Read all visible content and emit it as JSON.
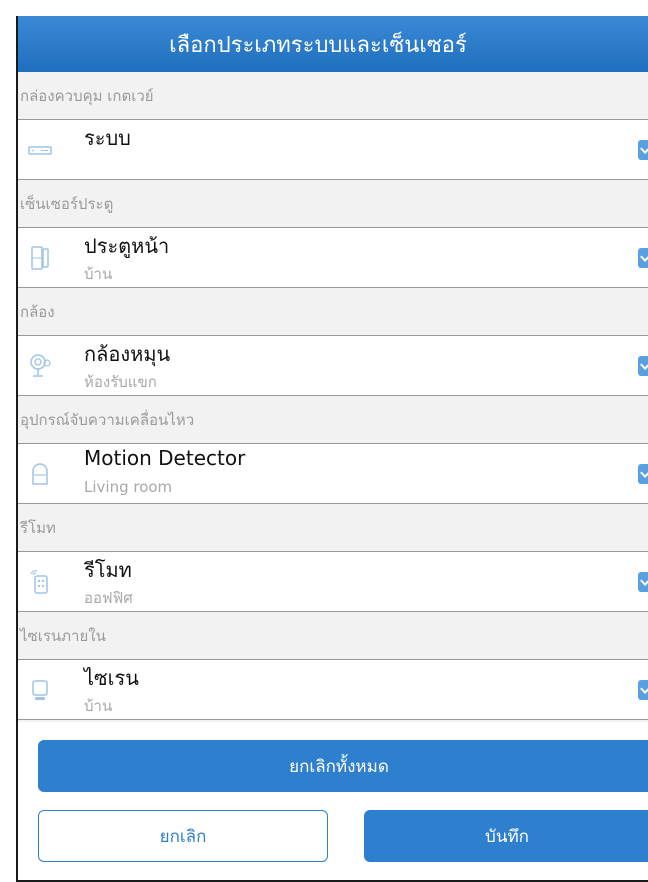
{
  "header": {
    "title": "เลือกประเภทระบบและเซ็นเซอร์"
  },
  "sections": [
    {
      "label": "กล่องควบคุม เกตเวย์",
      "item": {
        "title": "ระบบ",
        "subtitle": "",
        "icon": "gateway-icon",
        "checked": true
      }
    },
    {
      "label": "เซ็นเซอร์ประตู",
      "item": {
        "title": "ประตูหน้า",
        "subtitle": "บ้าน",
        "icon": "door-sensor-icon",
        "checked": true
      }
    },
    {
      "label": "กล้อง",
      "item": {
        "title": "กล้องหมุน",
        "subtitle": "ห้องรับแขก",
        "icon": "camera-icon",
        "checked": true
      }
    },
    {
      "label": "อุปกรณ์จับความเคลื่อนไหว",
      "item": {
        "title": "Motion Detector",
        "subtitle": "Living room",
        "icon": "motion-detector-icon",
        "checked": true
      }
    },
    {
      "label": "รีโมท",
      "item": {
        "title": "รีโมท",
        "subtitle": "ออฟฟิศ",
        "icon": "remote-icon",
        "checked": true
      }
    },
    {
      "label": "ไซเรนภายใน",
      "item": {
        "title": "ไซเรน",
        "subtitle": "บ้าน",
        "icon": "siren-icon",
        "checked": true
      }
    }
  ],
  "footer": {
    "deselect_all_label": "ยกเลิกทั้งหมด",
    "cancel_label": "ยกเลิก",
    "save_label": "บันทึก"
  },
  "colors": {
    "accent": "#2f7fcf",
    "header": "#2a7bcb",
    "section_bg": "#f2f2f2",
    "check": "#5aa0e0"
  }
}
